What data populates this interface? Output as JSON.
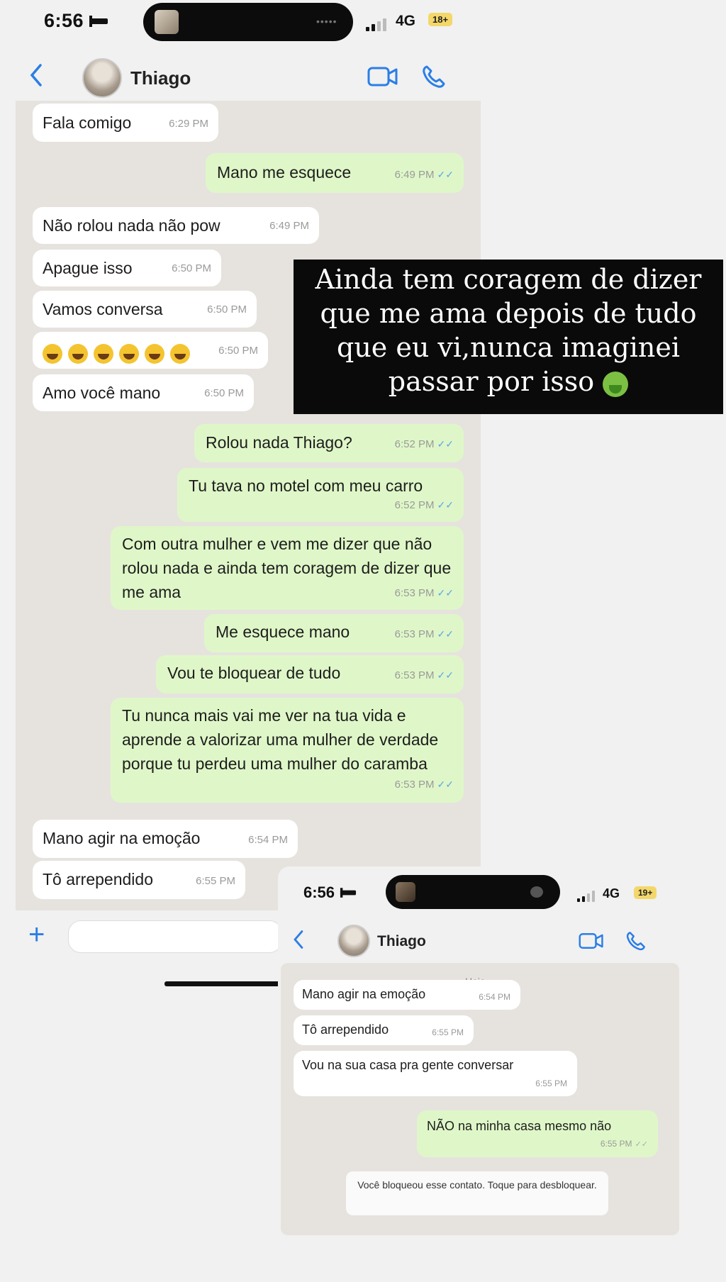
{
  "screen1": {
    "status": {
      "time": "6:56",
      "network": "4G",
      "badge": "18+"
    },
    "header": {
      "contact_name": "Thiago"
    },
    "messages": [
      {
        "dir": "in",
        "text": "Fala comigo",
        "time": "6:29 PM"
      },
      {
        "dir": "out",
        "text": "Mano me esquece",
        "time": "6:49 PM"
      },
      {
        "dir": "in",
        "text": "Não rolou nada não pow",
        "time": "6:49 PM"
      },
      {
        "dir": "in",
        "text": "Apague isso",
        "time": "6:50 PM"
      },
      {
        "dir": "in",
        "text": "Vamos conversa",
        "time": "6:50 PM"
      },
      {
        "dir": "in",
        "text": "",
        "time": "6:50 PM",
        "emoji": "grinning-sweat x6"
      },
      {
        "dir": "in",
        "text": "Amo você mano",
        "time": "6:50 PM"
      },
      {
        "dir": "out",
        "text": "Rolou nada Thiago?",
        "time": "6:52 PM"
      },
      {
        "dir": "out",
        "text": "Tu tava no motel com meu carro",
        "time": "6:52 PM"
      },
      {
        "dir": "out",
        "text": "Com outra mulher e vem me dizer que não rolou nada e ainda tem coragem de dizer que me ama",
        "time": "6:53 PM"
      },
      {
        "dir": "out",
        "text": "Me esquece mano",
        "time": "6:53 PM"
      },
      {
        "dir": "out",
        "text": "Vou te bloquear de tudo",
        "time": "6:53 PM"
      },
      {
        "dir": "out",
        "text": "Tu nunca mais vai me ver na tua vida e aprende a valorizar uma mulher de verdade porque tu perdeu uma mulher do caramba",
        "time": "6:53 PM"
      },
      {
        "dir": "in",
        "text": "Mano agir na emoção",
        "time": "6:54 PM"
      },
      {
        "dir": "in",
        "text": "Tô arrependido",
        "time": "6:55 PM"
      }
    ],
    "icons": {
      "back": "chevron-left-icon",
      "video": "video-camera-icon",
      "call": "phone-icon",
      "attach": "plus-icon"
    }
  },
  "overlay_caption": {
    "text": "Ainda tem coragem de dizer que me ama depois de tudo que eu vi,nunca imaginei passar por isso",
    "emoji": "nauseated-face-icon"
  },
  "screen2": {
    "status": {
      "time": "6:56",
      "network": "4G",
      "badge": "19+"
    },
    "header": {
      "contact_name": "Thiago"
    },
    "date_label": "Hoje",
    "messages": [
      {
        "dir": "in",
        "text": "Mano agir na emoção",
        "time": "6:54 PM"
      },
      {
        "dir": "in",
        "text": "Tô arrependido",
        "time": "6:55 PM"
      },
      {
        "dir": "in",
        "text": "Vou na sua casa pra gente conversar",
        "time": "6:55 PM"
      },
      {
        "dir": "out",
        "text": "NÃO na minha casa mesmo não",
        "time": "6:55 PM"
      }
    ],
    "blocked_notice": "Você bloqueou esse contato. Toque para desbloquear."
  },
  "colors": {
    "accent": "#2a7ee6",
    "outgoing_bubble": "#dff7c8",
    "incoming_bubble": "#ffffff",
    "chat_bg": "#e6e3df",
    "overlay_bg": "#0a0a0a"
  }
}
